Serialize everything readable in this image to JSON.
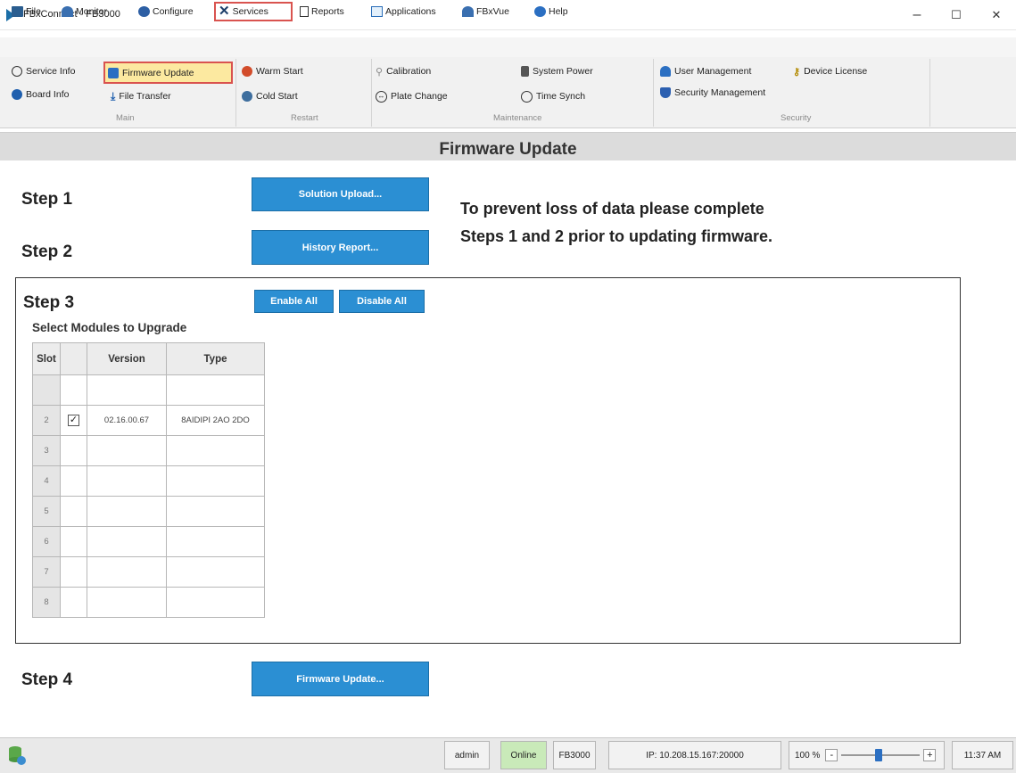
{
  "window": {
    "title": "FBxConnect - FB3000",
    "minimize": "–",
    "maximize": "☐",
    "close": "✕"
  },
  "menu": {
    "items": [
      {
        "label": "File",
        "icon": "folder-icon"
      },
      {
        "label": "Monitor",
        "icon": "monitor-icon"
      },
      {
        "label": "Configure",
        "icon": "gear-icon"
      },
      {
        "label": "Services",
        "icon": "wrench-icon"
      },
      {
        "label": "Reports",
        "icon": "report-icon"
      },
      {
        "label": "Applications",
        "icon": "applications-icon"
      },
      {
        "label": "FBxVue",
        "icon": "fbxvue-icon"
      },
      {
        "label": "Help",
        "icon": "help-icon"
      }
    ],
    "selected": "Services"
  },
  "ribbon": {
    "main": {
      "items": [
        "Service Info",
        "Firmware Update",
        "Board Info",
        "File Transfer"
      ],
      "label": "Main"
    },
    "restart": {
      "items": [
        "Warm Start",
        "Cold Start"
      ],
      "label": "Restart"
    },
    "maintenance": {
      "items": [
        "Calibration",
        "System Power",
        "Plate Change",
        "Time Synch"
      ],
      "label": "Maintenance"
    },
    "security": {
      "items": [
        "User Management",
        "Device License",
        "Security Management"
      ],
      "label": "Security"
    },
    "selected": "Firmware Update"
  },
  "page": {
    "title": "Firmware Update",
    "step1": {
      "label": "Step 1",
      "button": "Solution Upload..."
    },
    "step2": {
      "label": "Step 2",
      "button": "History Report..."
    },
    "notice_line1": "To prevent loss of data please complete",
    "notice_line2": "Steps 1 and 2 prior to updating firmware.",
    "step3": {
      "label": "Step 3",
      "enable_all": "Enable All",
      "disable_all": "Disable All",
      "subheading": "Select Modules to Upgrade",
      "columns": [
        "Slot",
        "",
        "Version",
        "Type"
      ],
      "rows": [
        {
          "slot": "",
          "checked": false,
          "version": "",
          "type": ""
        },
        {
          "slot": "2",
          "checked": true,
          "version": "02.16.00.67",
          "type": "8AIDIPI 2AO 2DO"
        },
        {
          "slot": "3",
          "checked": false,
          "version": "",
          "type": ""
        },
        {
          "slot": "4",
          "checked": false,
          "version": "",
          "type": ""
        },
        {
          "slot": "5",
          "checked": false,
          "version": "",
          "type": ""
        },
        {
          "slot": "6",
          "checked": false,
          "version": "",
          "type": ""
        },
        {
          "slot": "7",
          "checked": false,
          "version": "",
          "type": ""
        },
        {
          "slot": "8",
          "checked": false,
          "version": "",
          "type": ""
        }
      ],
      "check_mark": "✓"
    },
    "step4": {
      "label": "Step 4",
      "button": "Firmware Update..."
    }
  },
  "status": {
    "user": "admin",
    "connection": "Online",
    "device": "FB3000",
    "ip": "IP: 10.208.15.167:20000",
    "zoom": "100 %",
    "zoom_minus": "-",
    "zoom_plus": "+",
    "zoom_level_percent": 100,
    "time": "11:37 AM",
    "status_color_online": "#c9eab9"
  }
}
